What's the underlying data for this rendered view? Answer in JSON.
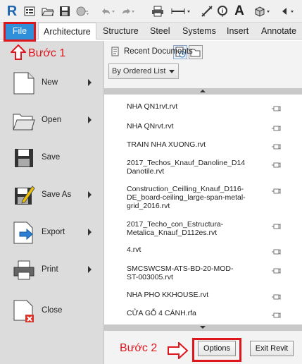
{
  "quick_access": {
    "icons": [
      "revit-logo-icon",
      "info-center-icon",
      "open-icon",
      "save-icon",
      "sync-icon",
      "undo-icon",
      "redo-icon",
      "print-icon",
      "measure-icon",
      "dimension-icon",
      "tag-icon",
      "text-icon",
      "view-3d-icon",
      "section-icon"
    ],
    "logo_letter": "R",
    "text_tool_letter": "A"
  },
  "ribbon": {
    "tabs": [
      {
        "label": "File",
        "active": true
      },
      {
        "label": "Architecture"
      },
      {
        "label": "Structure"
      },
      {
        "label": "Steel"
      },
      {
        "label": "Systems"
      },
      {
        "label": "Insert"
      },
      {
        "label": "Annotate"
      }
    ]
  },
  "annotations": {
    "step1": "Bước 1",
    "step2": "Bước 2",
    "color": "#e0161e"
  },
  "file_menu": {
    "items": [
      {
        "label": "New",
        "icon": "new-document-icon",
        "has_submenu": true
      },
      {
        "label": "Open",
        "icon": "open-folder-icon",
        "has_submenu": true
      },
      {
        "label": "Save",
        "icon": "save-floppy-icon",
        "has_submenu": false
      },
      {
        "label": "Save As",
        "icon": "save-as-icon",
        "has_submenu": true
      },
      {
        "label": "Export",
        "icon": "export-icon",
        "has_submenu": true
      },
      {
        "label": "Print",
        "icon": "printer-icon",
        "has_submenu": true
      },
      {
        "label": "Close",
        "icon": "close-document-icon",
        "has_submenu": false
      }
    ]
  },
  "recent_panel": {
    "title": "Recent Documents",
    "sort_dropdown": "By Ordered List",
    "documents": [
      "NHA QN1rvt.rvt",
      "NHA QNrvt.rvt",
      "TRAIN NHA XUONG.rvt",
      "2017_Techos_Knauf_Danoline_D14\nDanotile.rvt",
      "Construction_Ceilling_Knauf_D116-\nDE_board-ceiling_large-span-metal-\ngrid_2016.rvt",
      "2017_Techo_con_Estructura-\nMetalica_Knauf_D112es.rvt",
      "4.rvt",
      "SMCSWCSM-ATS-BD-20-MOD-\nST-003005.rvt",
      "NHA PHO KKHOUSE.rvt",
      "CỬA GỖ 4 CÁNH.rfa"
    ]
  },
  "buttons": {
    "options": "Options",
    "exit": "Exit Revit"
  },
  "colors": {
    "file_tab": "#2f8fd8",
    "menu_bg": "#dcdcdc",
    "panel_bg": "#f3f3f3"
  }
}
